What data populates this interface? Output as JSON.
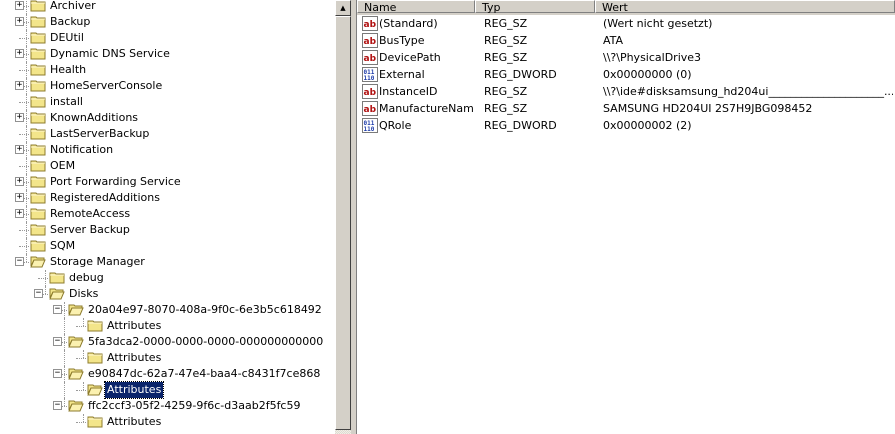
{
  "tree": {
    "scroll_up_glyph": "▲",
    "nodes": [
      {
        "label": "Archiver",
        "depth": 1,
        "expander": "+",
        "selected": false
      },
      {
        "label": "Backup",
        "depth": 1,
        "expander": "+",
        "selected": false
      },
      {
        "label": "DEUtil",
        "depth": 1,
        "expander": "",
        "selected": false
      },
      {
        "label": "Dynamic DNS Service",
        "depth": 1,
        "expander": "+",
        "selected": false
      },
      {
        "label": "Health",
        "depth": 1,
        "expander": "",
        "selected": false
      },
      {
        "label": "HomeServerConsole",
        "depth": 1,
        "expander": "+",
        "selected": false
      },
      {
        "label": "install",
        "depth": 1,
        "expander": "",
        "selected": false
      },
      {
        "label": "KnownAdditions",
        "depth": 1,
        "expander": "+",
        "selected": false
      },
      {
        "label": "LastServerBackup",
        "depth": 1,
        "expander": "",
        "selected": false
      },
      {
        "label": "Notification",
        "depth": 1,
        "expander": "+",
        "selected": false
      },
      {
        "label": "OEM",
        "depth": 1,
        "expander": "",
        "selected": false
      },
      {
        "label": "Port Forwarding Service",
        "depth": 1,
        "expander": "+",
        "selected": false
      },
      {
        "label": "RegisteredAdditions",
        "depth": 1,
        "expander": "+",
        "selected": false
      },
      {
        "label": "RemoteAccess",
        "depth": 1,
        "expander": "+",
        "selected": false
      },
      {
        "label": "Server Backup",
        "depth": 1,
        "expander": "",
        "selected": false
      },
      {
        "label": "SQM",
        "depth": 1,
        "expander": "",
        "selected": false
      },
      {
        "label": "Storage Manager",
        "depth": 1,
        "expander": "−",
        "selected": false
      },
      {
        "label": "debug",
        "depth": 2,
        "expander": "",
        "selected": false
      },
      {
        "label": "Disks",
        "depth": 2,
        "expander": "−",
        "selected": false
      },
      {
        "label": "20a04e97-8070-408a-9f0c-6e3b5c618492",
        "depth": 3,
        "expander": "−",
        "selected": false
      },
      {
        "label": "Attributes",
        "depth": 4,
        "expander": "",
        "selected": false
      },
      {
        "label": "5fa3dca2-0000-0000-0000-000000000000",
        "depth": 3,
        "expander": "−",
        "selected": false
      },
      {
        "label": "Attributes",
        "depth": 4,
        "expander": "",
        "selected": false
      },
      {
        "label": "e90847dc-62a7-47e4-baa4-c8431f7ce868",
        "depth": 3,
        "expander": "−",
        "selected": false
      },
      {
        "label": "Attributes",
        "depth": 4,
        "expander": "",
        "selected": true
      },
      {
        "label": "ffc2ccf3-05f2-4259-9f6c-d3aab2f5fc59",
        "depth": 3,
        "expander": "−",
        "selected": false
      },
      {
        "label": "Attributes",
        "depth": 4,
        "expander": "",
        "selected": false
      }
    ]
  },
  "values": {
    "columns": {
      "name": "Name",
      "type": "Typ",
      "data": "Wert"
    },
    "rows": [
      {
        "name": "(Standard)",
        "type": "REG_SZ",
        "data": "(Wert nicht gesetzt)",
        "icon": "string-value-icon"
      },
      {
        "name": "BusType",
        "type": "REG_SZ",
        "data": "ATA",
        "icon": "string-value-icon"
      },
      {
        "name": "DevicePath",
        "type": "REG_SZ",
        "data": "\\\\?\\PhysicalDrive3",
        "icon": "string-value-icon"
      },
      {
        "name": "External",
        "type": "REG_DWORD",
        "data": "0x00000000 (0)",
        "icon": "binary-value-icon"
      },
      {
        "name": "InstanceID",
        "type": "REG_SZ",
        "data": "\\\\?\\ide#disksamsung_hd204ui_____________________...",
        "icon": "string-value-icon"
      },
      {
        "name": "ManufactureName",
        "type": "REG_SZ",
        "data": "SAMSUNG HD204UI 2S7H9JBG098452",
        "icon": "string-value-icon"
      },
      {
        "name": "QRole",
        "type": "REG_DWORD",
        "data": "0x00000002 (2)",
        "icon": "binary-value-icon"
      }
    ]
  },
  "colors": {
    "selection": "#0a246a",
    "folder": "#f3e58a",
    "folder_edge": "#8c7b2c"
  }
}
